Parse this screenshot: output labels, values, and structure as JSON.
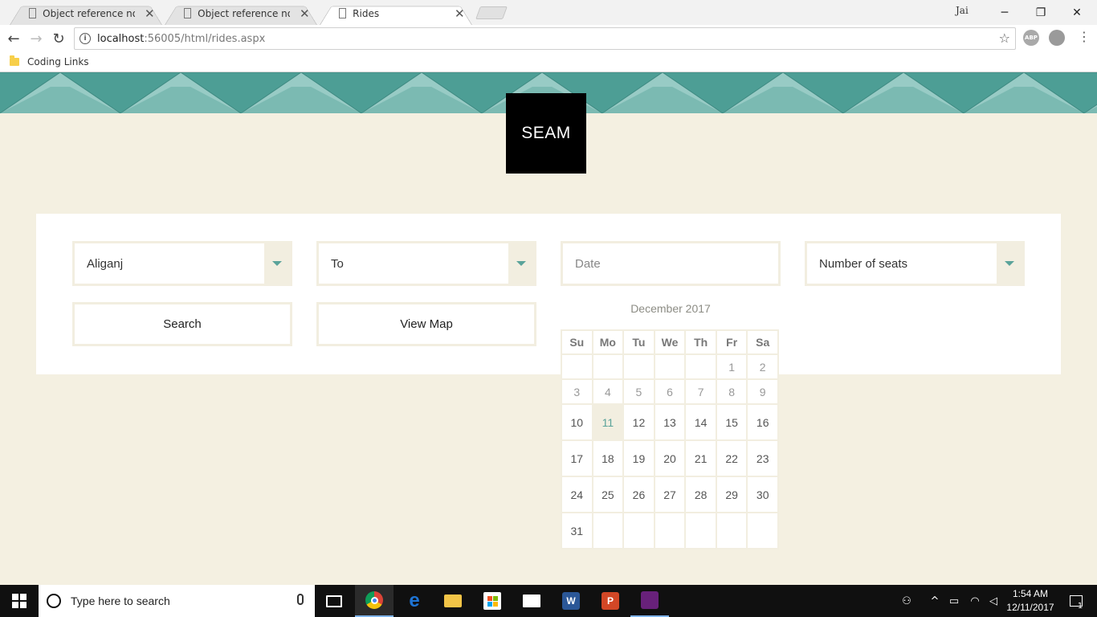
{
  "browser": {
    "tabs": [
      {
        "title": "Object reference not set t",
        "close": "✕"
      },
      {
        "title": "Object reference not set t",
        "close": "✕"
      },
      {
        "title": "Rides",
        "close": "✕"
      }
    ],
    "profile_label": "Jai",
    "window_controls": {
      "minimize": "─",
      "maximize": "❐",
      "close": "✕"
    },
    "nav": {
      "back": "←",
      "forward": "→",
      "reload": "↻"
    },
    "url": {
      "host": "localhost",
      "path": ":56005/html/rides.aspx"
    },
    "bookmark_icon": "☆",
    "extensions": [
      {
        "label": "ABP",
        "color": "#a9a9a9"
      },
      {
        "label": "",
        "color": "#9a9a9a"
      }
    ],
    "menu_icon": "⋮",
    "bookmarks": [
      {
        "label": "Coding Links",
        "icon": "folder-icon"
      }
    ]
  },
  "page": {
    "logo_text": "SEAM",
    "colors": {
      "banner_dark": "#4d9e95",
      "banner_light": "#98cbc5",
      "background": "#f4f0e1",
      "accent": "#5aa39a"
    },
    "form": {
      "from_value": "Aliganj",
      "to_placeholder": "To",
      "date_placeholder": "Date",
      "seats_placeholder": "Number of seats",
      "search_label": "Search",
      "view_map_label": "View Map"
    },
    "calendar": {
      "title": "December 2017",
      "weekdays": [
        "Su",
        "Mo",
        "Tu",
        "We",
        "Th",
        "Fr",
        "Sa"
      ],
      "weeks": [
        [
          "",
          "",
          "",
          "",
          "",
          "1",
          "2"
        ],
        [
          "3",
          "4",
          "5",
          "6",
          "7",
          "8",
          "9"
        ],
        [
          "10",
          "11",
          "12",
          "13",
          "14",
          "15",
          "16"
        ],
        [
          "17",
          "18",
          "19",
          "20",
          "21",
          "22",
          "23"
        ],
        [
          "24",
          "25",
          "26",
          "27",
          "28",
          "29",
          "30"
        ],
        [
          "31",
          "",
          "",
          "",
          "",
          "",
          ""
        ]
      ],
      "today": "11"
    }
  },
  "taskbar": {
    "search_placeholder": "Type here to search",
    "apps": [
      {
        "name": "task-view",
        "label": "",
        "color": "#101010"
      },
      {
        "name": "chrome",
        "label": "",
        "color": "#e8c43a"
      },
      {
        "name": "edge",
        "label": "e",
        "color": "#1e74d4"
      },
      {
        "name": "file-explorer",
        "label": "",
        "color": "#f2c447"
      },
      {
        "name": "store",
        "label": "",
        "color": "#ffffff"
      },
      {
        "name": "mail",
        "label": "",
        "color": "#ffffff"
      },
      {
        "name": "word",
        "label": "W",
        "color": "#2b5797"
      },
      {
        "name": "powerpoint",
        "label": "P",
        "color": "#d24726"
      },
      {
        "name": "visual-studio",
        "label": "",
        "color": "#68217a"
      }
    ],
    "time": "1:54 AM",
    "date": "12/11/2017",
    "notifications": "1"
  }
}
